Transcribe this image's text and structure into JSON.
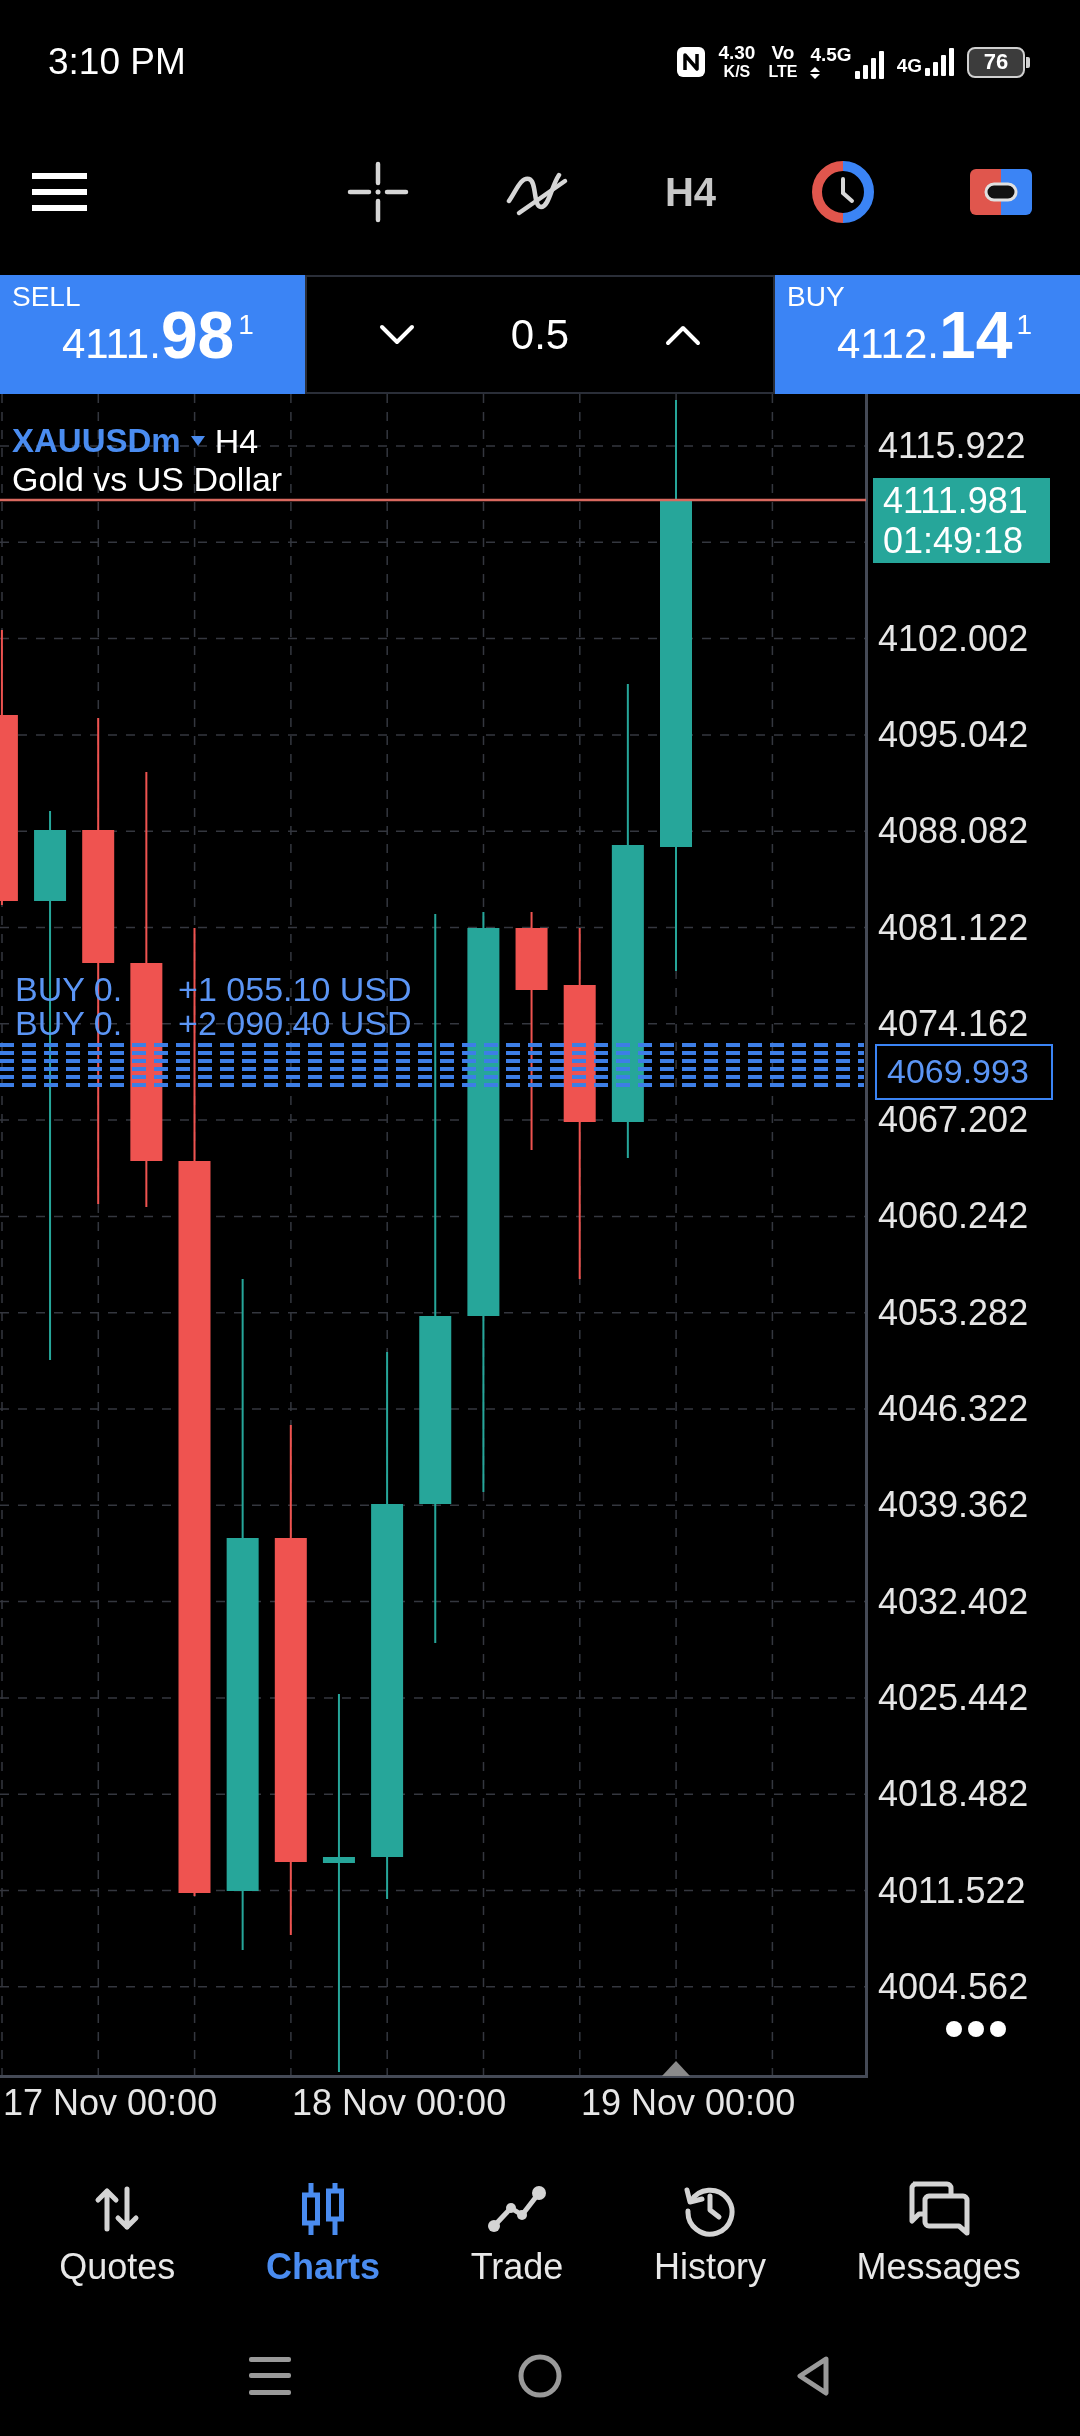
{
  "status_bar": {
    "time": "3:10 PM",
    "speed_value": "4.30",
    "speed_unit": "K/S",
    "volte_top": "Vo",
    "volte_bottom": "LTE",
    "sim1_network": "4.5G",
    "sim2_network": "4G",
    "battery": "76"
  },
  "toolbar": {
    "timeframe": "H4"
  },
  "trade_panel": {
    "sell": {
      "label": "SELL",
      "price_main": "4111.",
      "price_big": "98",
      "price_sup": "1"
    },
    "volume": "0.5",
    "buy": {
      "label": "BUY",
      "price_main": "4112.",
      "price_big": "14",
      "price_sup": "1"
    }
  },
  "chart": {
    "symbol": "XAUUSDm",
    "timeframe": "H4",
    "description": "Gold vs US Dollar",
    "price_axis": [
      "4115.922",
      "4102.002",
      "4095.042",
      "4088.082",
      "4081.122",
      "4074.162",
      "4067.202",
      "4060.242",
      "4053.282",
      "4046.322",
      "4039.362",
      "4032.402",
      "4025.442",
      "4018.482",
      "4011.522",
      "4004.562"
    ],
    "current_price": "4111.981",
    "bar_countdown": "01:49:18",
    "positions": [
      {
        "label": "BUY 0.",
        "profit": "+1 055.10 USD"
      },
      {
        "label": "BUY 0.",
        "profit": "+2 090.40 USD"
      }
    ],
    "position_price": "4069.993",
    "time_axis": [
      "17 Nov 00:00",
      "18 Nov 00:00",
      "19 Nov 00:00"
    ]
  },
  "bottom_nav": [
    {
      "label": "Quotes",
      "selected": false
    },
    {
      "label": "Charts",
      "selected": true
    },
    {
      "label": "Trade",
      "selected": false
    },
    {
      "label": "History",
      "selected": false
    },
    {
      "label": "Messages",
      "selected": false
    }
  ]
}
